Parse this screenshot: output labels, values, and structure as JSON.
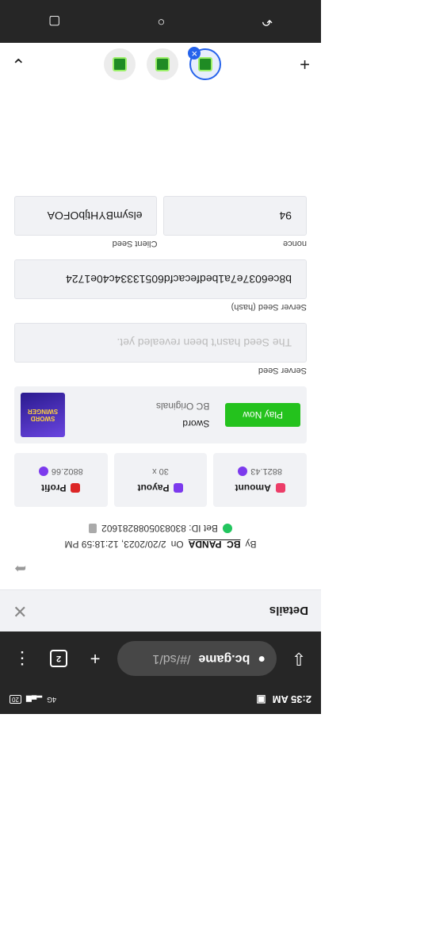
{
  "status": {
    "time": "2:35 AM",
    "battery": "20",
    "network": "4G"
  },
  "browser": {
    "host": "bc.game",
    "path": "/#/sd/1",
    "tab_count": "2"
  },
  "panel": {
    "title": "Details"
  },
  "bet": {
    "by_label": "By",
    "user": "BC_PANDA",
    "on_label": "On",
    "datetime": "2/20/2023, 12:18:59 PM",
    "id_label": "Bet ID: 8308305088281602"
  },
  "stats": [
    {
      "label": "Amount",
      "value": "8821.43",
      "color": "#ec3d68"
    },
    {
      "label": "Payout",
      "value": "30 x",
      "color": "#7c3aed"
    },
    {
      "label": "Profit",
      "value": "8802.66",
      "color": "#dc2626"
    }
  ],
  "game": {
    "name": "Sword",
    "category": "BC Originals",
    "button": "Play Now",
    "thumb_text": "SWORD SWINGER"
  },
  "fields": {
    "server_seed_label": "Server Seed",
    "server_seed_value": "The Seed hasn't been revealed yet.",
    "hash_label": "Server Seed (hash)",
    "hash_value": "b8ce6037e7a1bedfecacfd60513334c40e1724",
    "client_label": "Client Seed",
    "client_value": "elsymBYHtjbOFOA",
    "nonce_label": "nonce",
    "nonce_value": "94"
  },
  "colors": {
    "accent": "#24c21d",
    "brand_blue": "#2563eb"
  }
}
